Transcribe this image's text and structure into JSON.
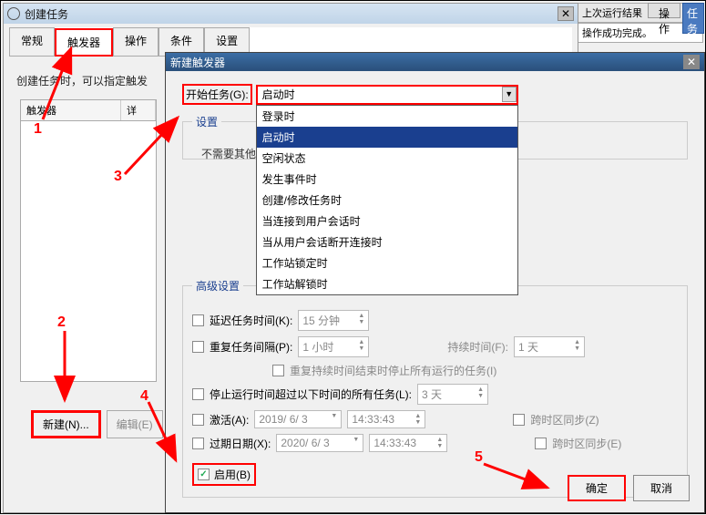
{
  "main_window": {
    "title": "创建任务",
    "tabs": [
      "常规",
      "触发器",
      "操作",
      "条件",
      "设置"
    ],
    "active_tab": "触发器",
    "desc": "创建任务时，可以指定触发",
    "list": {
      "col1": "触发器",
      "col2": "详"
    },
    "btn_new": "新建(N)...",
    "btn_edit": "编辑(E)"
  },
  "sidebar": {
    "title": "上次运行结果",
    "status": "操作成功完成。",
    "btn1": "操作",
    "btn2": "任务"
  },
  "trigger_dialog": {
    "title": "新建触发器",
    "begin_label": "开始任务(G):",
    "selected": "启动时",
    "options": [
      "登录时",
      "启动时",
      "空闲状态",
      "发生事件时",
      "创建/修改任务时",
      "当连接到用户会话时",
      "当从用户会话断开连接时",
      "工作站锁定时",
      "工作站解锁时"
    ],
    "settings_label": "设置",
    "settings_text": "不需要其他设",
    "adv_label": "高级设置",
    "delay_label": "延迟任务时间(K):",
    "delay_val": "15 分钟",
    "repeat_label": "重复任务间隔(P):",
    "repeat_val": "1 小时",
    "duration_label": "持续时间(F):",
    "duration_val": "1 天",
    "repeat_stop": "重复持续时间结束时停止所有运行的任务(I)",
    "stop_after_label": "停止运行时间超过以下时间的所有任务(L):",
    "stop_after_val": "3 天",
    "activate_label": "激活(A):",
    "activate_date": "2019/ 6/ 3",
    "activate_time": "14:33:43",
    "tz_sync1": "跨时区同步(Z)",
    "expire_label": "过期日期(X):",
    "expire_date": "2020/ 6/ 3",
    "expire_time": "14:33:43",
    "tz_sync2": "跨时区同步(E)",
    "enable_label": "启用(B)",
    "ok": "确定",
    "cancel": "取消"
  },
  "annotations": {
    "n1": "1",
    "n2": "2",
    "n3": "3",
    "n4": "4",
    "n5": "5"
  }
}
